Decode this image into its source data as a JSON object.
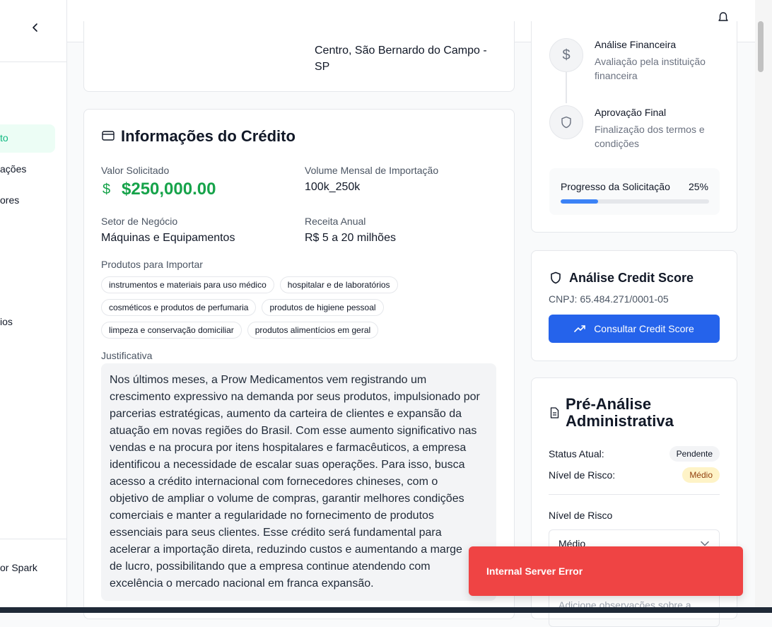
{
  "sidebar": {
    "items": [
      {
        "label": "to",
        "active": true
      },
      {
        "label": "ações"
      },
      {
        "label": "ores"
      },
      {
        "label": "ios"
      }
    ],
    "footer": "or Spark"
  },
  "company_card": {
    "address_line1": "Centro, São Bernardo do Campo -",
    "address_line2": "SP"
  },
  "credit": {
    "title": "Informações do Crédito",
    "valor_label": "Valor Solicitado",
    "valor_symbol": "$",
    "valor": "$250,000.00",
    "volume_label": "Volume Mensal de Importação",
    "volume": "100k_250k",
    "setor_label": "Setor de Negócio",
    "setor": "Máquinas e Equipamentos",
    "receita_label": "Receita Anual",
    "receita": "R$ 5 a 20 milhões",
    "produtos_label": "Produtos para Importar",
    "produtos": [
      "instrumentos e materiais para uso médico",
      "hospitalar e de laboratórios",
      "cosméticos e produtos de perfumaria",
      "produtos de higiene pessoal",
      "limpeza e conservação domiciliar",
      "produtos alimentícios em geral"
    ],
    "justificativa_label": "Justificativa",
    "justificativa_lines": [
      "Nos últimos meses, a Prow Medicamentos vem registrando um",
      "crescimento expressivo na demanda por seus produtos, impulsionado por",
      "parcerias estratégicas, aumento da carteira de clientes e expansão da",
      "atuação em novas regiões do Brasil. Com esse aumento significativo nas",
      "vendas e na procura por itens hospitalares e farmacêuticos, a empresa",
      "identificou a necessidade de escalar suas operações. Para isso, busca",
      "acesso a crédito internacional com fornecedores chineses, com o",
      "objetivo de ampliar o volume de compras, garantir melhores condições",
      "comerciais e manter a regularidade no fornecimento de produtos",
      "essenciais para seus clientes. Esse crédito será fundamental para",
      "acelerar a importação direta, reduzindo custos e aumentando a marge",
      "de lucro, possibilitando que a empresa continue atendendo com",
      "excelência o mercado nacional em franca expansão."
    ]
  },
  "steps": [
    {
      "title": "Análise Financeira",
      "desc1": "Avaliação pela instituição",
      "desc2": "financeira",
      "icon": "dollar-icon"
    },
    {
      "title": "Aprovação Final",
      "desc1": "Finalização dos termos e",
      "desc2": "condições",
      "icon": "shield-icon"
    }
  ],
  "progress": {
    "label": "Progresso da Solicitação",
    "percent_text": "25%",
    "value": 0.25
  },
  "credit_score": {
    "title": "Análise Credit Score",
    "cnpj": "CNPJ: 65.484.271/0001-05",
    "button": "Consultar Credit Score"
  },
  "pre_analise": {
    "title_line1": "Pré-Análise",
    "title_line2": "Administrativa",
    "status_label": "Status Atual:",
    "status_value": "Pendente",
    "risco_label": "Nível de Risco:",
    "risco_value": "Médio",
    "select_label": "Nível de Risco",
    "select_value": "Médio",
    "obs_placeholder": "Adicione observações sobre a"
  },
  "toast": {
    "message": "Internal Server Error"
  },
  "colors": {
    "accent_green": "#10b981",
    "money_green": "#16a34a",
    "primary_blue": "#2563eb",
    "error_red": "#ef4444",
    "warning_yellow": "#fef3c7"
  }
}
